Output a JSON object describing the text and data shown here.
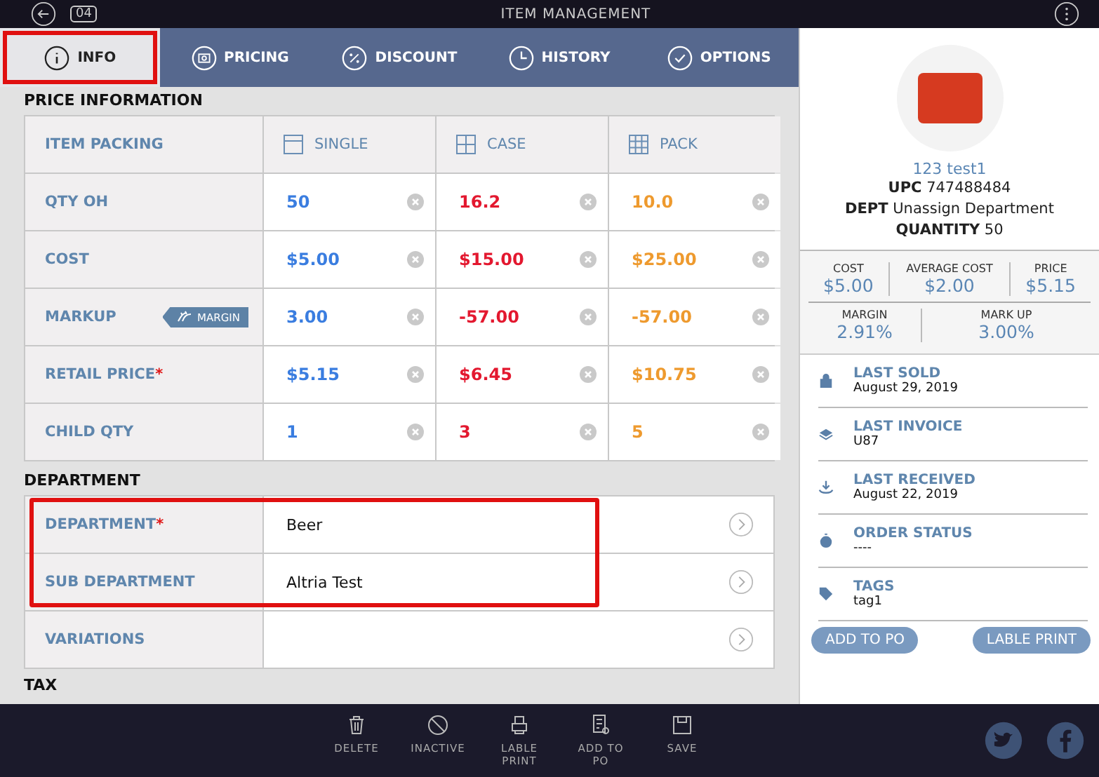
{
  "top_bar": {
    "badge": "04",
    "title": "ITEM MANAGEMENT"
  },
  "tabs": [
    {
      "label": "INFO",
      "selected": true,
      "highlighted": true
    },
    {
      "label": "PRICING",
      "selected": false,
      "highlighted": false
    },
    {
      "label": "DISCOUNT",
      "selected": false,
      "highlighted": false
    },
    {
      "label": "HISTORY",
      "selected": false,
      "highlighted": false
    },
    {
      "label": "OPTIONS",
      "selected": false,
      "highlighted": false
    }
  ],
  "price_information": {
    "heading": "PRICE INFORMATION",
    "corner": "ITEM PACKING",
    "columns": [
      {
        "label": "SINGLE",
        "color": "#3a7de0"
      },
      {
        "label": "CASE",
        "color": "#e3182f"
      },
      {
        "label": "PACK",
        "color": "#ee9a2e"
      }
    ],
    "rows": [
      {
        "label": "QTY OH",
        "values": [
          "50",
          "16.2",
          "10.0"
        ]
      },
      {
        "label": "COST",
        "values": [
          "$5.00",
          "$15.00",
          "$25.00"
        ]
      },
      {
        "label": "MARKUP",
        "badge": "MARGIN",
        "values": [
          "3.00",
          "-57.00",
          "-57.00"
        ]
      },
      {
        "label": "RETAIL PRICE",
        "required_mark": "*",
        "values": [
          "$5.15",
          "$6.45",
          "$10.75"
        ]
      },
      {
        "label": "CHILD QTY",
        "values": [
          "1",
          "3",
          "5"
        ]
      }
    ]
  },
  "department": {
    "heading": "DEPARTMENT",
    "rows": [
      {
        "label": "DEPARTMENT",
        "required_mark": "*",
        "value": "Beer",
        "highlighted": true
      },
      {
        "label": "SUB DEPARTMENT",
        "value": "Altria Test",
        "highlighted": true
      },
      {
        "label": "VARIATIONS"
      }
    ]
  },
  "tax_heading": "TAX",
  "item": {
    "name": "123 test1",
    "details": [
      {
        "label": "UPC",
        "value": "747488484"
      },
      {
        "label": "DEPT",
        "value": "Unassign Department"
      },
      {
        "label": "QUANTITY",
        "value": "50"
      }
    ]
  },
  "stats": [
    [
      {
        "label": "COST",
        "value": "$5.00"
      },
      {
        "label": "AVERAGE COST",
        "value": "$2.00"
      },
      {
        "label": "PRICE",
        "value": "$5.15"
      }
    ],
    [
      {
        "label": "MARGIN",
        "value": "2.91%"
      },
      {
        "label": "MARK UP",
        "value": "3.00%"
      }
    ]
  ],
  "activity": [
    {
      "label": "LAST SOLD",
      "value": "August 29, 2019"
    },
    {
      "label": "LAST INVOICE",
      "value": "U87"
    },
    {
      "label": "LAST RECEIVED",
      "value": "August 22, 2019"
    },
    {
      "label": "ORDER STATUS",
      "value": "----"
    },
    {
      "label": "TAGS",
      "value": "tag1"
    }
  ],
  "actions": [
    "ADD TO PO",
    "LABLE PRINT"
  ],
  "toolbar": [
    "DELETE",
    "INACTIVE",
    "LABLE PRINT",
    "ADD TO PO",
    "SAVE"
  ]
}
